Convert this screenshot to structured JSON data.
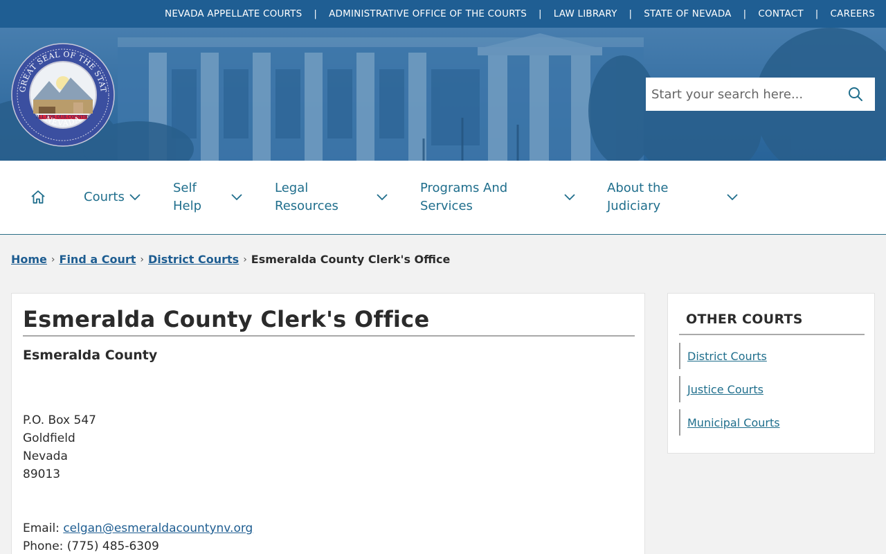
{
  "topbar": {
    "links": [
      "NEVADA APPELLATE COURTS",
      "ADMINISTRATIVE OFFICE OF THE COURTS",
      "LAW LIBRARY",
      "STATE OF NEVADA",
      "CONTACT",
      "CAREERS"
    ],
    "separator": "|"
  },
  "header": {
    "seal": {
      "top_text": "THE GREAT SEAL OF THE STATE OF",
      "bottom_text": "NEVADA",
      "motto": "ALL FOR OUR COUNTRY"
    },
    "search": {
      "placeholder": "Start your search here..."
    }
  },
  "nav": {
    "home_icon": "home-icon",
    "items": [
      {
        "label_line1": "Courts",
        "label_line2": ""
      },
      {
        "label_line1": "Self",
        "label_line2": "Help"
      },
      {
        "label_line1": "Legal",
        "label_line2": "Resources"
      },
      {
        "label_line1": "Programs And",
        "label_line2": "Services"
      },
      {
        "label_line1": "About the",
        "label_line2": "Judiciary"
      }
    ]
  },
  "breadcrumb": {
    "items": [
      "Home",
      "Find a Court",
      "District Courts"
    ],
    "current": "Esmeralda County Clerk's Office"
  },
  "main": {
    "title": "Esmeralda County Clerk's Office",
    "county": "Esmeralda County",
    "address": [
      "P.O. Box 547",
      "Goldfield",
      "Nevada",
      "89013"
    ],
    "email_label": "Email:",
    "email": "celgan@esmeraldacountynv.org",
    "phone_label": "Phone:",
    "phone": "(775) 485-6309"
  },
  "sidebar": {
    "title": "OTHER COURTS",
    "links": [
      "District Courts",
      "Justice Courts",
      "Municipal Courts"
    ]
  },
  "colors": {
    "topbar": "#1f5e93",
    "nav_text": "#1f6e8c",
    "link": "#1e5d91",
    "background": "#f2f2f2"
  }
}
